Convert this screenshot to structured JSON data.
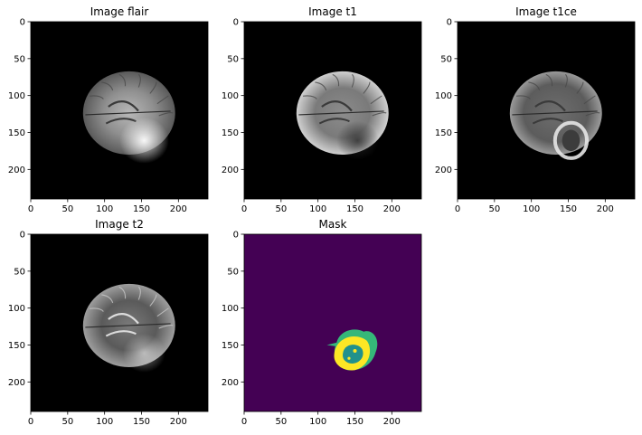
{
  "panels": [
    {
      "title": "Image flair",
      "kind": "mri",
      "modality": "flair"
    },
    {
      "title": "Image t1",
      "kind": "mri",
      "modality": "t1"
    },
    {
      "title": "Image t1ce",
      "kind": "mri",
      "modality": "t1ce"
    },
    {
      "title": "Image t2",
      "kind": "mri",
      "modality": "t2"
    },
    {
      "title": "Mask",
      "kind": "mask",
      "modality": "mask"
    }
  ],
  "axes": {
    "x_ticks": [
      "0",
      "50",
      "100",
      "150",
      "200"
    ],
    "y_ticks": [
      "0",
      "50",
      "100",
      "150",
      "200"
    ],
    "range": [
      0,
      240
    ]
  },
  "colors": {
    "image_background": "#000000",
    "mask_background": "#440154",
    "mask_class_1": "#21918c",
    "mask_class_2": "#35b779",
    "mask_class_3": "#fde725"
  }
}
